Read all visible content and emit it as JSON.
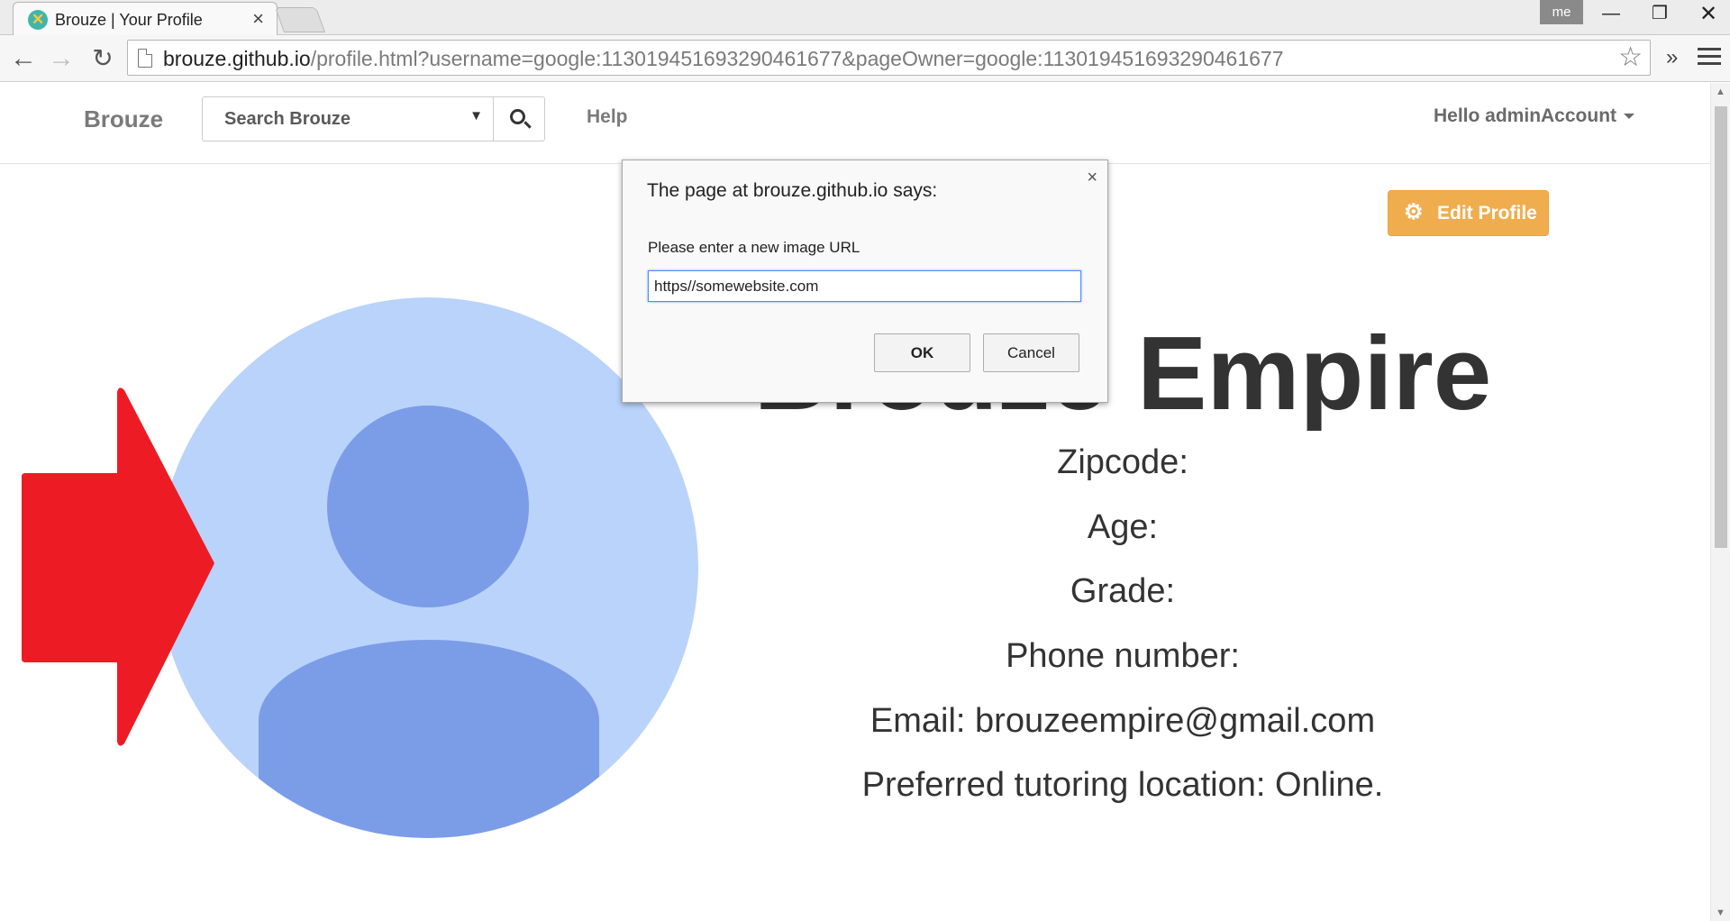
{
  "browser": {
    "tab_title": "Brouze | Your Profile",
    "tab_close": "×",
    "profile_badge": "me",
    "window_min": "—",
    "window_max": "❐",
    "window_close": "✕",
    "url_host": "brouze.github.io",
    "url_path": "/profile.html?username=google:113019451693290461677&pageOwner=google:113019451693290461677",
    "star": "☆",
    "extensions_more": "»"
  },
  "site": {
    "brand": "Brouze",
    "search_placeholder": "Search Brouze",
    "search_caret": "▼",
    "help_link": "Help",
    "user_menu": "Hello adminAccount"
  },
  "profile": {
    "edit_button": "Edit Profile",
    "name": "Brouze Empire",
    "zipcode": "Zipcode:",
    "age": "Age:",
    "grade": "Grade:",
    "phone": "Phone number:",
    "email": "Email: brouzeempire@gmail.com",
    "location": "Preferred tutoring location: Online."
  },
  "dialog": {
    "title": "The page at brouze.github.io says:",
    "message": "Please enter a new image URL",
    "input_value": "https//somewebsite.com",
    "ok": "OK",
    "cancel": "Cancel",
    "close": "×"
  },
  "colors": {
    "arrow": "#ed1c24",
    "avatar_bg": "#bad3fb",
    "avatar_fg": "#7b9de8",
    "edit_button": "#f0ad4e"
  }
}
